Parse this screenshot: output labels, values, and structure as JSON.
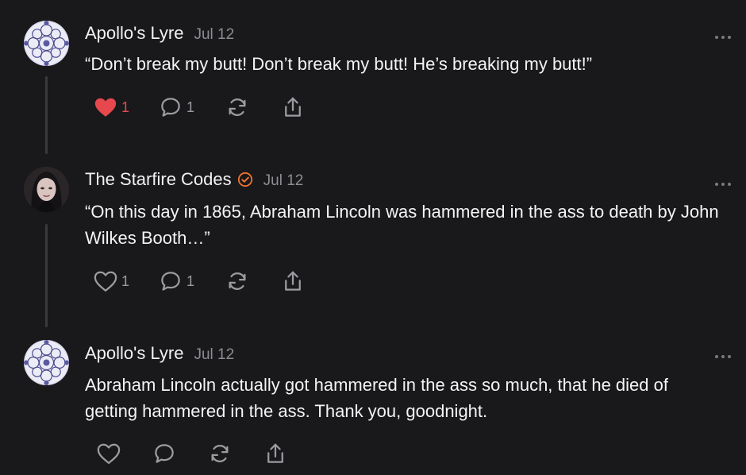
{
  "posts": [
    {
      "author": "Apollo's Lyre",
      "date": "Jul 12",
      "verified": false,
      "text": "“Don’t break my butt! Don’t break my butt! He’s breaking my butt!”",
      "likes": "1",
      "liked": true,
      "comments": "1"
    },
    {
      "author": "The Starfire Codes",
      "date": "Jul 12",
      "verified": true,
      "text": "“On this day in 1865, Abraham Lincoln was hammered in the ass to death by John Wilkes Booth…”",
      "likes": "1",
      "liked": false,
      "comments": "1"
    },
    {
      "author": "Apollo's Lyre",
      "date": "Jul 12",
      "verified": false,
      "text": "Abraham Lincoln actually got hammered in the ass so much, that he died of getting hammered in the ass. Thank you, goodnight.",
      "likes": "",
      "liked": false,
      "comments": ""
    }
  ],
  "colors": {
    "background": "#19181b",
    "like_active": "#e6484e",
    "verified_badge": "#f0742f",
    "muted": "#8e8d92"
  },
  "icons": [
    "heart-icon",
    "comment-icon",
    "repost-icon",
    "share-icon",
    "more-icon",
    "verified-icon"
  ]
}
